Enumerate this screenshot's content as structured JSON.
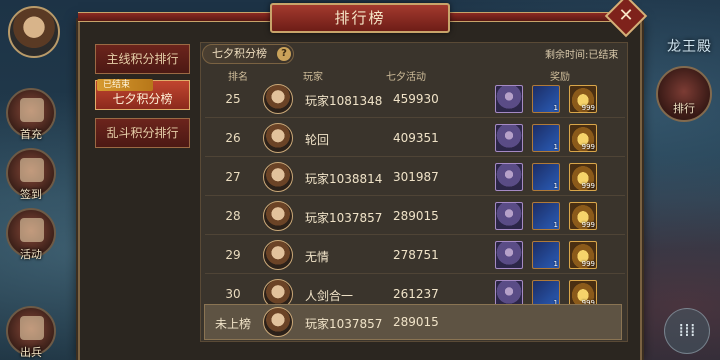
{
  "window": {
    "title": "排行榜",
    "close_label": "✕"
  },
  "side_left": {
    "buttons": [
      {
        "label": "首充"
      },
      {
        "label": "签到"
      },
      {
        "label": "活动"
      },
      {
        "label": "出兵"
      }
    ]
  },
  "side_right": {
    "title": "龙王殿",
    "rank_label": "排行",
    "menu_label": "⁞⁞⁞"
  },
  "tabs": [
    {
      "label": "主线积分排行",
      "active": false
    },
    {
      "label": "七夕积分榜",
      "active": true,
      "badge": "已结束"
    },
    {
      "label": "乱斗积分排行",
      "active": false
    }
  ],
  "board": {
    "subtitle": "七夕积分榜",
    "help": "?",
    "remaining": "剩余时间:已结束",
    "columns": {
      "rank": "排名",
      "player": "玩家",
      "score": "七夕活动",
      "reward": "奖励"
    },
    "rows": [
      {
        "rank": "25",
        "name": "玩家1081348",
        "score": "459930",
        "rewards": [
          "",
          "1",
          "999"
        ]
      },
      {
        "rank": "26",
        "name": "轮回",
        "score": "409351",
        "rewards": [
          "",
          "1",
          "999"
        ]
      },
      {
        "rank": "27",
        "name": "玩家1038814",
        "score": "301987",
        "rewards": [
          "",
          "1",
          "999"
        ]
      },
      {
        "rank": "28",
        "name": "玩家1037857",
        "score": "289015",
        "rewards": [
          "",
          "1",
          "999"
        ]
      },
      {
        "rank": "29",
        "name": "无情",
        "score": "278751",
        "rewards": [
          "",
          "1",
          "999"
        ]
      },
      {
        "rank": "30",
        "name": "人剑合一",
        "score": "261237",
        "rewards": [
          "",
          "1",
          "999"
        ]
      }
    ],
    "my_rank": {
      "rank": "未上榜",
      "name": "玩家1037857",
      "score": "289015"
    }
  }
}
